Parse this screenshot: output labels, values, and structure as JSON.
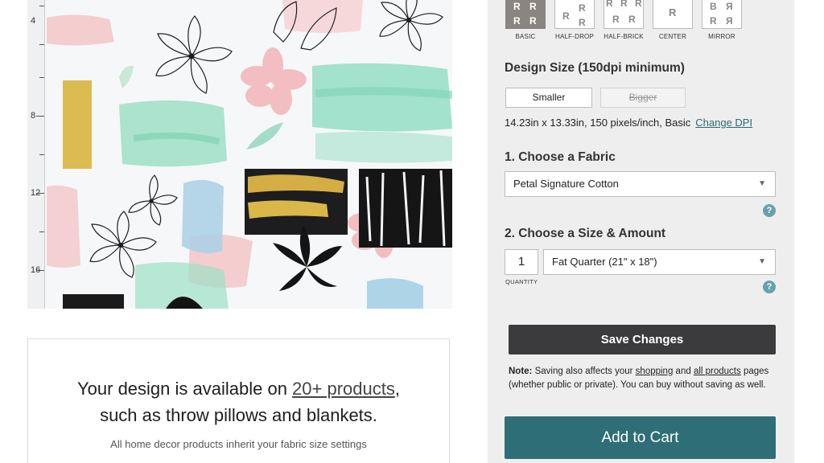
{
  "preview": {
    "ruler_labels": [
      "4",
      "8",
      "12",
      "16"
    ]
  },
  "products_card": {
    "line1_prefix": "Your design is available on ",
    "line1_link": "20+ products",
    "line1_suffix": ",",
    "line2": "such as throw pillows and blankets.",
    "sub": "All home decor products inherit your fabric size settings"
  },
  "repeat": {
    "options": [
      {
        "label": "BASIC",
        "active": true
      },
      {
        "label": "HALF-DROP",
        "active": false
      },
      {
        "label": "HALF-BRICK",
        "active": false
      },
      {
        "label": "CENTER",
        "active": false
      },
      {
        "label": "MIRROR",
        "active": false
      }
    ]
  },
  "design_size": {
    "title": "Design Size (150dpi minimum)",
    "smaller_label": "Smaller",
    "bigger_label": "Bigger",
    "info": "14.23in x 13.33in, 150 pixels/inch, Basic",
    "change_dpi": "Change DPI"
  },
  "fabric": {
    "title": "1. Choose a Fabric",
    "selected": "Petal Signature Cotton"
  },
  "size_amount": {
    "title": "2. Choose a Size & Amount",
    "quantity": "1",
    "quantity_label": "QUANTITY",
    "size_selected": "Fat Quarter (21\" x 18\")"
  },
  "help_glyph": "?",
  "save_label": "Save Changes",
  "note": {
    "label": "Note:",
    "text1": " Saving also affects your ",
    "link_shopping": "shopping",
    "text2": " and ",
    "link_all": "all products",
    "text3": " pages (whether public or private). You can buy without saving as well."
  },
  "cart_label": "Add to Cart",
  "colors": {
    "panel_bg": "#eeeeef",
    "save_bg": "#3b3b3d",
    "cart_bg": "#2e6e76",
    "help_bg": "#66a3a8"
  }
}
